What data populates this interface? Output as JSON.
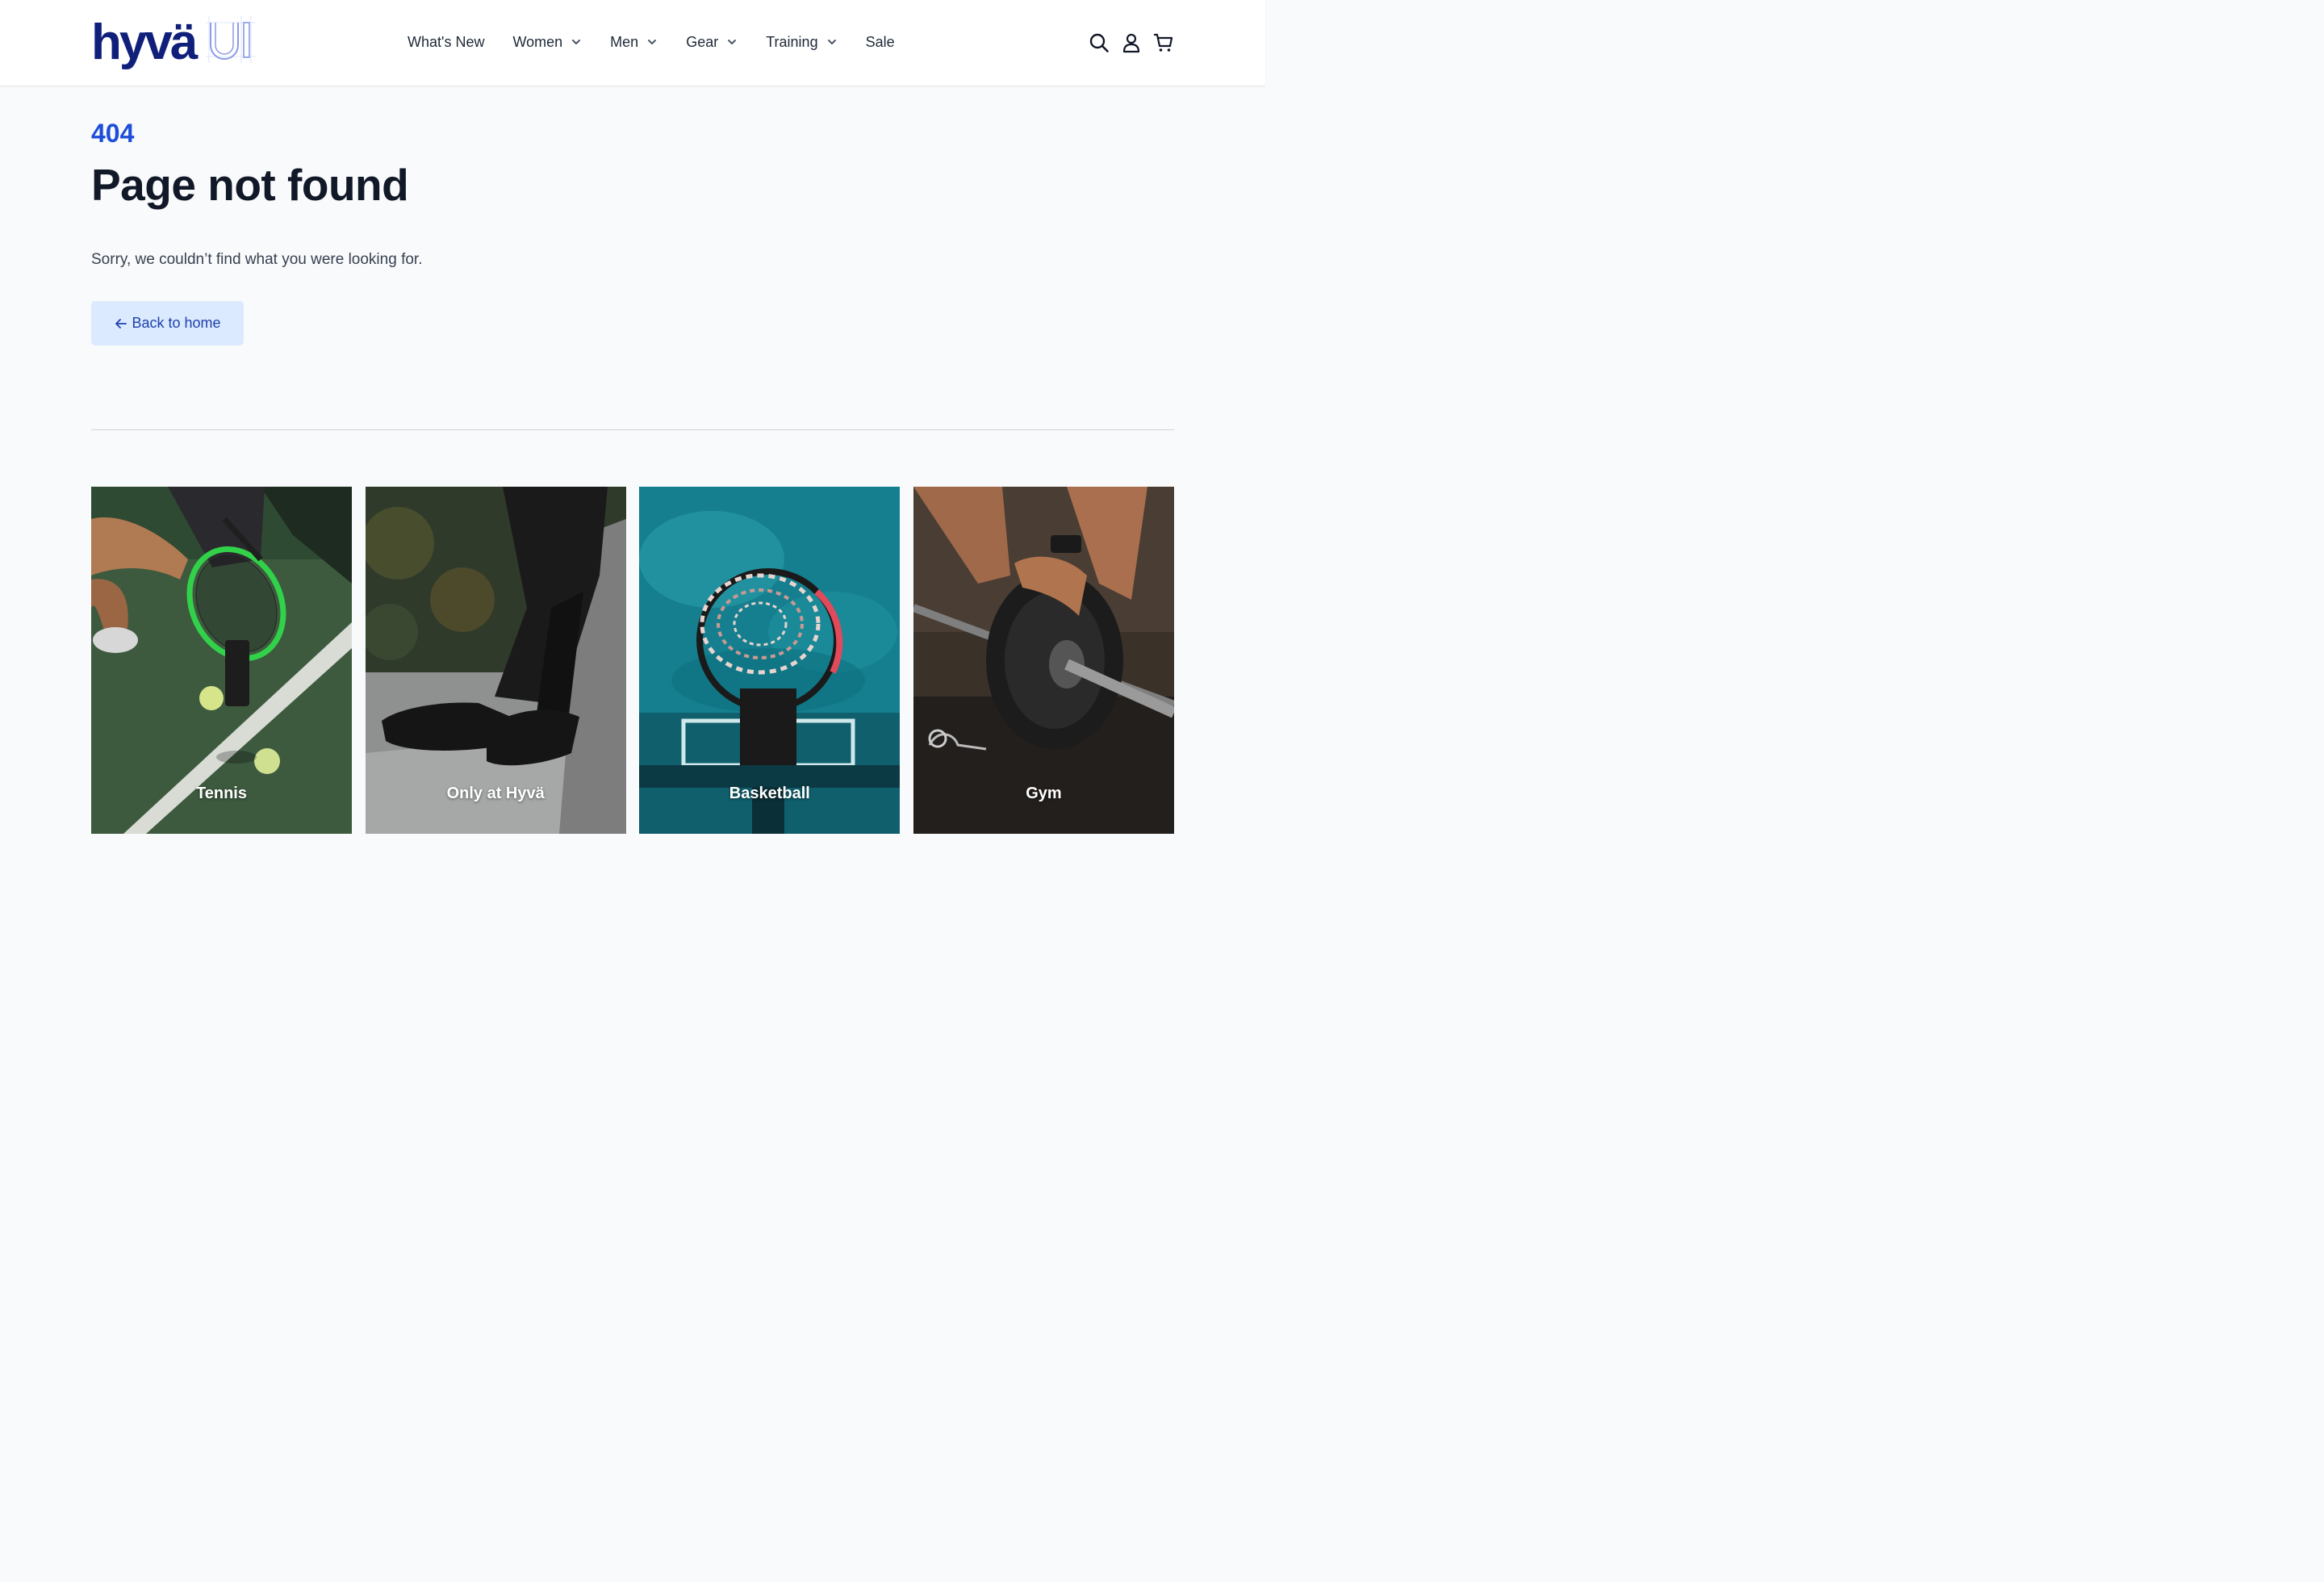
{
  "brand": {
    "logo_text": "hyvä",
    "logo_suffix": "UI",
    "primary_color": "#10207a",
    "accent_color": "#1d4ed8"
  },
  "nav": {
    "items": [
      {
        "label": "What's New",
        "has_dropdown": false
      },
      {
        "label": "Women",
        "has_dropdown": true
      },
      {
        "label": "Men",
        "has_dropdown": true
      },
      {
        "label": "Gear",
        "has_dropdown": true
      },
      {
        "label": "Training",
        "has_dropdown": true
      },
      {
        "label": "Sale",
        "has_dropdown": false
      }
    ]
  },
  "header_icons": [
    "search-icon",
    "account-icon",
    "cart-icon"
  ],
  "error": {
    "code": "404",
    "title": "Page not found",
    "description": "Sorry, we couldn’t find what you were looking for.",
    "back_label": "Back to home",
    "back_icon": "arrow-left-icon"
  },
  "categories": [
    {
      "label": "Tennis"
    },
    {
      "label": "Only at Hyvä"
    },
    {
      "label": "Basketball"
    },
    {
      "label": "Gym"
    }
  ]
}
